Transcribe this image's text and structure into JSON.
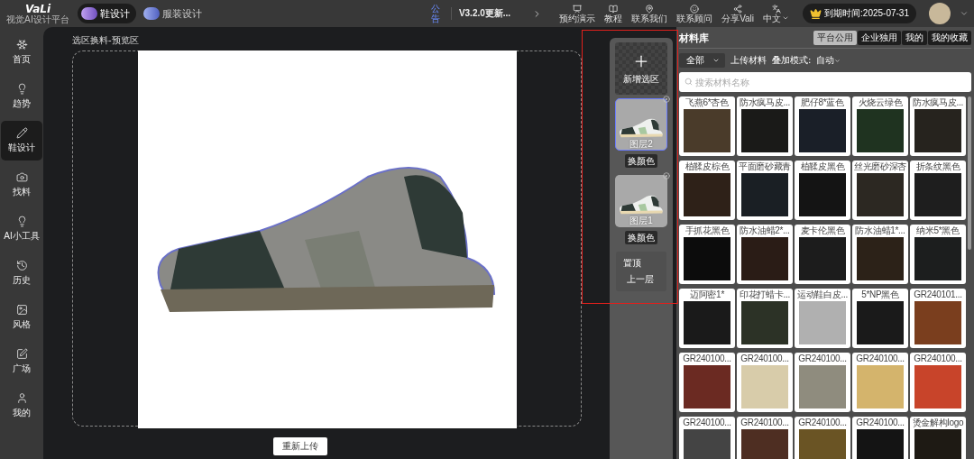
{
  "topbar": {
    "logo": "VaLi",
    "logo_subtitle": "视觉AI设计平台",
    "modes": [
      {
        "label": "鞋设计",
        "selected": true
      },
      {
        "label": "服装设计",
        "selected": false
      }
    ],
    "notice": {
      "label": "公告",
      "text": "V3.2.0更新..."
    },
    "actions": [
      {
        "label": "预约演示"
      },
      {
        "label": "教程"
      },
      {
        "label": "联系我们"
      },
      {
        "label": "联系顾问"
      },
      {
        "label": "分享Vali"
      },
      {
        "label": "中文",
        "dropdown": true
      }
    ],
    "expiry": "到期时间:2025-07-31"
  },
  "sidebar": {
    "items": [
      {
        "label": "首页",
        "selected": false
      },
      {
        "label": "趋势",
        "selected": false
      },
      {
        "label": "鞋设计",
        "selected": true
      },
      {
        "label": "找料",
        "selected": false
      },
      {
        "label": "AI小工具",
        "selected": false
      },
      {
        "label": "历史",
        "selected": false
      },
      {
        "label": "风格",
        "selected": false
      },
      {
        "label": "广场",
        "selected": false
      },
      {
        "label": "我的",
        "selected": false
      }
    ]
  },
  "canvas": {
    "title": "选区换料-预览区",
    "reupload_button": "重新上传"
  },
  "layers": {
    "add_button": "新增选区",
    "items": [
      {
        "name": "图层2",
        "selected": true,
        "recolor_button": "换颜色"
      },
      {
        "name": "图层1",
        "selected": false,
        "recolor_button": "换颜色"
      }
    ],
    "menu": [
      "置顶",
      "上一层"
    ]
  },
  "materials": {
    "title": "材料库",
    "tabs": [
      {
        "label": "平台公用",
        "selected": true
      },
      {
        "label": "企业独用",
        "selected": false
      },
      {
        "label": "我的",
        "selected": false
      },
      {
        "label": "我的收藏",
        "selected": false
      }
    ],
    "filter": "全部",
    "upload": "上传材料",
    "blend_label": "叠加模式:",
    "blend_value": "自动",
    "search": {
      "placeholder": "搜索材料名称"
    },
    "items": [
      {
        "name": "飞燕6*杏色",
        "color": "#4a3b2a"
      },
      {
        "name": "防水疯马皮...",
        "color": "#1a1a18"
      },
      {
        "name": "肥仔8*蓝色",
        "color": "#1a1f28"
      },
      {
        "name": "火烧云绿色",
        "color": "#1f3320"
      },
      {
        "name": "防水疯马皮...",
        "color": "#26231e"
      },
      {
        "name": "植鞣皮棕色",
        "color": "#2e2118"
      },
      {
        "name": "平面磨砂藏青",
        "color": "#1a1f24"
      },
      {
        "name": "植鞣皮黑色",
        "color": "#141414"
      },
      {
        "name": "丝光磨砂深杏",
        "color": "#2c2822"
      },
      {
        "name": "折条纹黑色",
        "color": "#1e1e1e"
      },
      {
        "name": "手抓花黑色",
        "color": "#0c0c0c"
      },
      {
        "name": "防水油蜡2*...",
        "color": "#2a1c16"
      },
      {
        "name": "麦卡伦黑色",
        "color": "#1c1c1c"
      },
      {
        "name": "防水油蜡1*...",
        "color": "#2c2218"
      },
      {
        "name": "纳米5*黑色",
        "color": "#1c1e1e"
      },
      {
        "name": "迈阿密1*",
        "color": "#1a1a1a"
      },
      {
        "name": "印花打蜡卡...",
        "color": "#2c3226"
      },
      {
        "name": "运动鞋白皮...",
        "color": "#b0b0b0"
      },
      {
        "name": "5*NP黑色",
        "color": "#1a1a1a"
      },
      {
        "name": "GR240101...",
        "color": "#7a3e1e"
      },
      {
        "name": "GR240100...",
        "color": "#6b2a22"
      },
      {
        "name": "GR240100...",
        "color": "#d8ccaa"
      },
      {
        "name": "GR240100...",
        "color": "#8f8c7e"
      },
      {
        "name": "GR240100...",
        "color": "#d4b46c"
      },
      {
        "name": "GR240100...",
        "color": "#c8442a"
      },
      {
        "name": "GR240100...",
        "color": "#444444"
      },
      {
        "name": "GR240100...",
        "color": "#4e2e22"
      },
      {
        "name": "GR240100...",
        "color": "#6a5424"
      },
      {
        "name": "GR240100...",
        "color": "#141414"
      },
      {
        "name": "烫金解构logo",
        "color": "#1e1a14"
      }
    ]
  }
}
